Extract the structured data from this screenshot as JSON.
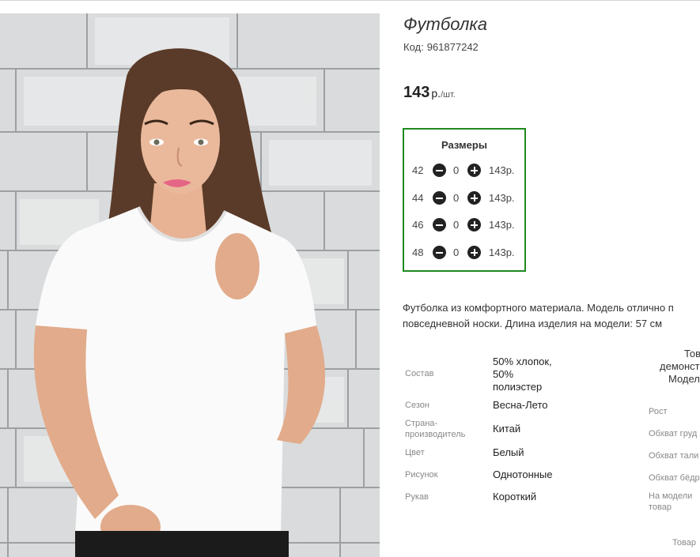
{
  "product": {
    "title": "Футболка",
    "code_label": "Код:",
    "code_value": "961877242",
    "price_value": "143",
    "price_unit": "р.",
    "price_per": "/шт."
  },
  "sizes": {
    "title": "Размеры",
    "rows": [
      {
        "size": "42",
        "qty": "0",
        "price": "143р."
      },
      {
        "size": "44",
        "qty": "0",
        "price": "143р."
      },
      {
        "size": "46",
        "qty": "0",
        "price": "143р."
      },
      {
        "size": "48",
        "qty": "0",
        "price": "143р."
      }
    ]
  },
  "description": {
    "line1": "Футболка из комфортного материала. Модель отлично п",
    "line2": "повседневной носки. Длина изделия на модели: 57 см"
  },
  "properties": [
    {
      "label": "Состав",
      "value_lines": [
        "50% хлопок,",
        "50%",
        "полиэстер"
      ]
    },
    {
      "label": "Сезон",
      "value": "Весна-Лето"
    },
    {
      "label_lines": [
        "Страна-",
        "производитель"
      ],
      "value": "Китай"
    },
    {
      "label": "Цвет",
      "value": "Белый"
    },
    {
      "label": "Рисунок",
      "value": "Однотонные"
    },
    {
      "label": "Рукав",
      "value": "Короткий"
    }
  ],
  "model_params": {
    "head_lines": [
      "Тов",
      "демонст",
      "Модел"
    ],
    "labels": [
      "Рост",
      "Обхват груд",
      "Обхват тали",
      "Обхват бёдр",
      "На модели",
      "товар",
      "Товар"
    ]
  },
  "colors": {
    "sizes_border": "#1e8a1e",
    "button_fill": "#222222"
  },
  "icons": {
    "minus": "minus-circle-icon",
    "plus": "plus-circle-icon"
  }
}
